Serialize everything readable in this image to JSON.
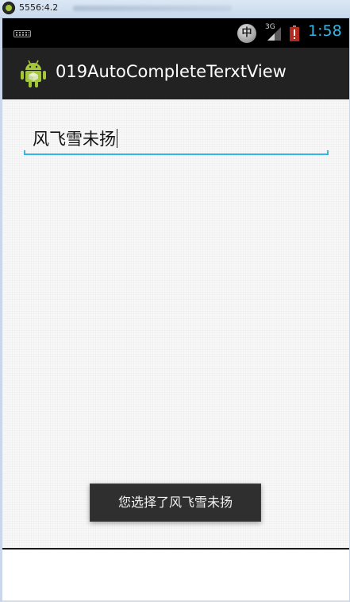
{
  "window": {
    "title": "5556:4.2",
    "icon": "android-emulator-icon"
  },
  "status_bar": {
    "keyboard_icon": "keyboard-icon",
    "ime_label": "中",
    "network_type": "3G",
    "signal_icon": "signal-icon",
    "battery_icon": "battery-alert-icon",
    "time": "1:58",
    "clock_color": "#33b5e5"
  },
  "action_bar": {
    "app_icon": "android-robot-icon",
    "title": "019AutoCompleteTerxtView"
  },
  "main": {
    "autocomplete_input": {
      "value": "风飞雪未扬",
      "accent_color": "#33b5e5"
    },
    "toast": {
      "message": "您选择了风飞雪未扬"
    }
  }
}
